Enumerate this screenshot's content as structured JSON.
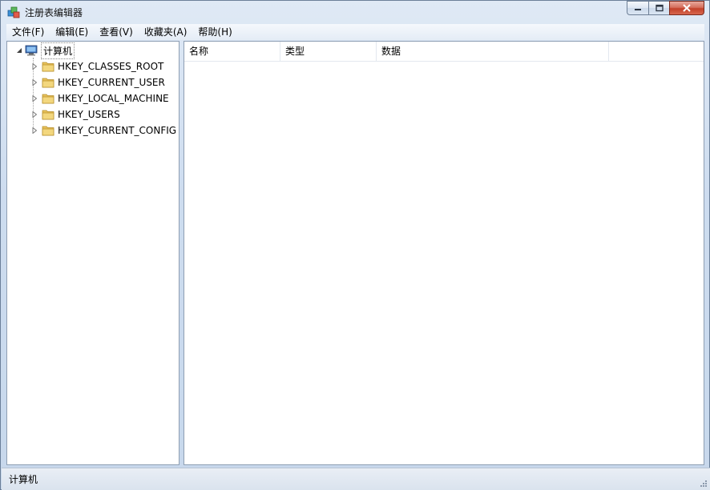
{
  "window": {
    "title": "注册表编辑器",
    "controls": {
      "minimize": "minimize-icon",
      "maximize": "maximize-icon",
      "close": "close-icon"
    }
  },
  "menu": [
    {
      "label": "文件(F)"
    },
    {
      "label": "编辑(E)"
    },
    {
      "label": "查看(V)"
    },
    {
      "label": "收藏夹(A)"
    },
    {
      "label": "帮助(H)"
    }
  ],
  "tree": {
    "root": {
      "label": "计算机",
      "icon": "computer-icon",
      "expanded": true
    },
    "keys": [
      {
        "label": "HKEY_CLASSES_ROOT",
        "icon": "folder-icon"
      },
      {
        "label": "HKEY_CURRENT_USER",
        "icon": "folder-icon"
      },
      {
        "label": "HKEY_LOCAL_MACHINE",
        "icon": "folder-icon"
      },
      {
        "label": "HKEY_USERS",
        "icon": "folder-icon"
      },
      {
        "label": "HKEY_CURRENT_CONFIG",
        "icon": "folder-icon"
      }
    ]
  },
  "list": {
    "columns": [
      "名称",
      "类型",
      "数据"
    ],
    "rows": []
  },
  "status": {
    "text": "计算机"
  },
  "colors": {
    "folder": "#e8c25c",
    "selection": "#cce8ff"
  }
}
